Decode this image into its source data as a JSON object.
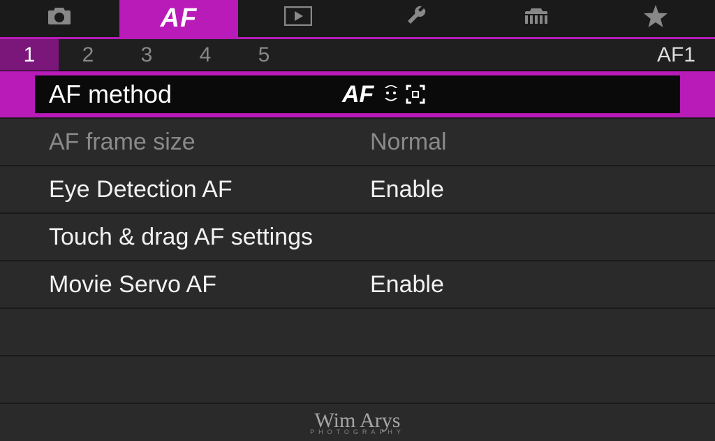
{
  "tabs": {
    "active_index": 1,
    "af_label": "AF"
  },
  "pages": {
    "items": [
      "1",
      "2",
      "3",
      "4",
      "5"
    ],
    "active_index": 0,
    "label": "AF1"
  },
  "menu": {
    "rows": [
      {
        "label": "AF method",
        "value_prefix": "AF"
      },
      {
        "label": "AF frame size",
        "value": "Normal"
      },
      {
        "label": "Eye Detection AF",
        "value": "Enable"
      },
      {
        "label": "Touch & drag AF settings",
        "value": ""
      },
      {
        "label": "Movie Servo AF",
        "value": "Enable"
      }
    ]
  },
  "watermark": {
    "main": "Wim Arys",
    "sub": "PHOTOGRAPHY"
  }
}
